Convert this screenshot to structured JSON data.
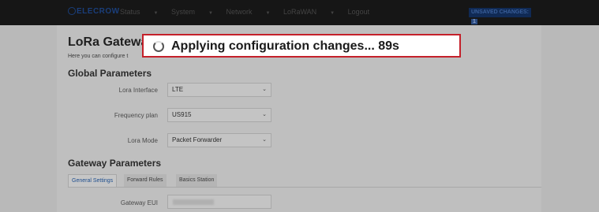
{
  "topbar": {
    "logo_text": "ELECROW",
    "nav": [
      {
        "label": "Status",
        "dropdown": true
      },
      {
        "label": "System",
        "dropdown": true
      },
      {
        "label": "Network",
        "dropdown": true
      },
      {
        "label": "LoRaWAN",
        "dropdown": true
      },
      {
        "label": "Logout",
        "dropdown": false
      }
    ],
    "unsaved_label": "UNSAVED CHANGES:",
    "unsaved_count": "1"
  },
  "page": {
    "title": "LoRa Gatewa",
    "description": "Here you can configure t"
  },
  "global": {
    "heading": "Global Parameters",
    "fields": [
      {
        "label": "Lora Interface",
        "value": "LTE"
      },
      {
        "label": "Frequency plan",
        "value": "US915"
      },
      {
        "label": "Lora Mode",
        "value": "Packet Forwarder"
      }
    ]
  },
  "gateway": {
    "heading": "Gateway Parameters",
    "tabs": [
      "General Settings",
      "Forward Rules",
      "Basics Station"
    ],
    "active_tab": 0,
    "eui_label": "Gateway EUI"
  },
  "modal": {
    "text": "Applying configuration changes... 89s"
  },
  "colors": {
    "accent": "#c4202a",
    "link": "#1f4f8f",
    "overlay": "#b9b9b9"
  }
}
